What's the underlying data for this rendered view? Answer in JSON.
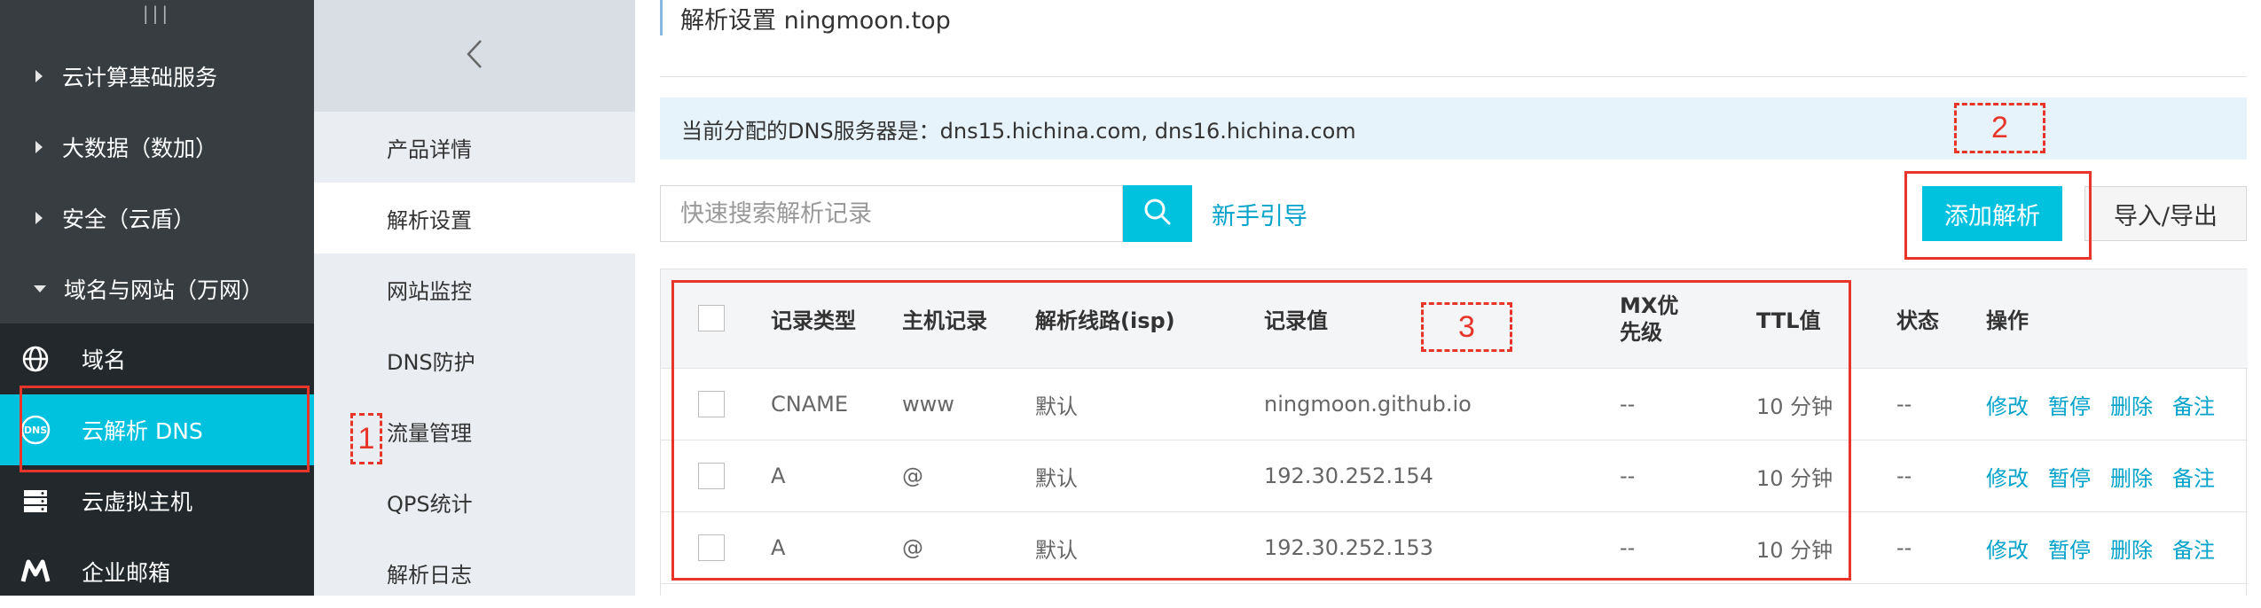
{
  "sidebar": {
    "categories": [
      {
        "label": "云计算基础服务",
        "expanded": false
      },
      {
        "label": "大数据（数加）",
        "expanded": false
      },
      {
        "label": "安全（云盾）",
        "expanded": false
      },
      {
        "label": "域名与网站（万网）",
        "expanded": true
      }
    ],
    "services": [
      {
        "label": "域名",
        "icon": "globe-icon",
        "active": false
      },
      {
        "label": "云解析 DNS",
        "icon": "dns-icon",
        "active": true
      },
      {
        "label": "云虚拟主机",
        "icon": "server-icon",
        "active": false
      },
      {
        "label": "企业邮箱",
        "icon": "mail-m-icon",
        "active": false
      }
    ]
  },
  "submenu": {
    "items": [
      {
        "label": "产品详情",
        "active": false
      },
      {
        "label": "解析设置",
        "active": true
      },
      {
        "label": "网站监控",
        "active": false
      },
      {
        "label": "DNS防护",
        "active": false
      },
      {
        "label": "流量管理",
        "active": false
      },
      {
        "label": "QPS统计",
        "active": false
      },
      {
        "label": "解析日志",
        "active": false
      }
    ]
  },
  "main": {
    "title": "解析设置 ningmoon.top",
    "dns_notice": "当前分配的DNS服务器是：dns15.hichina.com, dns16.hichina.com",
    "search_placeholder": "快速搜索解析记录",
    "guide_link": "新手引导",
    "add_button": "添加解析",
    "import_button": "导入/导出"
  },
  "table": {
    "headers": [
      "记录类型",
      "主机记录",
      "解析线路(isp)",
      "记录值",
      "MX优先级",
      "TTL值",
      "状态",
      "操作"
    ],
    "rows": [
      {
        "type": "CNAME",
        "host": "www",
        "line": "默认",
        "value": "ningmoon.github.io",
        "mx": "--",
        "ttl": "10 分钟",
        "status": "--"
      },
      {
        "type": "A",
        "host": "@",
        "line": "默认",
        "value": "192.30.252.154",
        "mx": "--",
        "ttl": "10 分钟",
        "status": "--"
      },
      {
        "type": "A",
        "host": "@",
        "line": "默认",
        "value": "192.30.252.153",
        "mx": "--",
        "ttl": "10 分钟",
        "status": "--"
      }
    ],
    "actions": [
      "修改",
      "暂停",
      "删除",
      "备注"
    ]
  },
  "annotations": {
    "one": "1",
    "two": "2",
    "three": "3"
  },
  "colors": {
    "accent": "#00c1de",
    "sidebar": "#373d41",
    "annotation": "#e8352a",
    "link": "#00a2ca"
  }
}
